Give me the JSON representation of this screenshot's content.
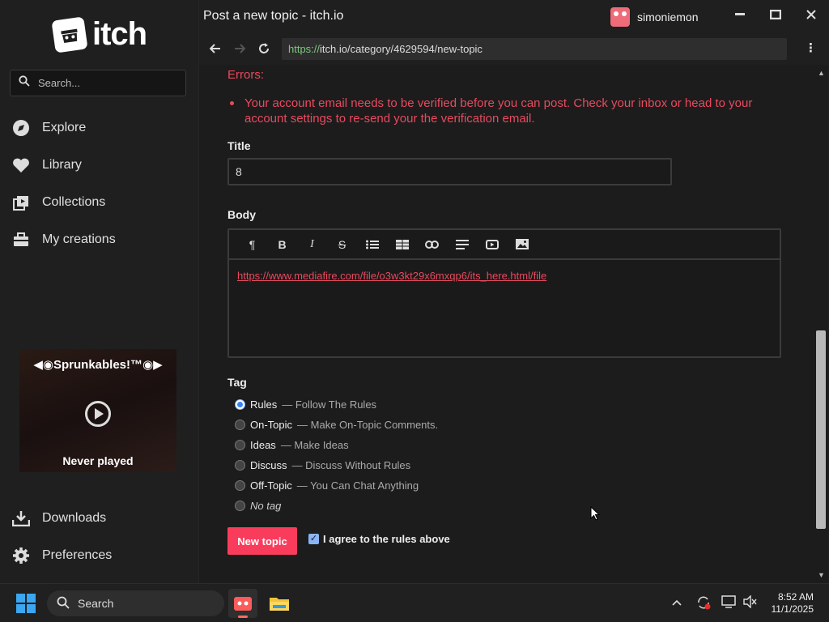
{
  "window": {
    "title": "Post a new topic - itch.io"
  },
  "user": {
    "name": "simoniemon"
  },
  "url": {
    "scheme": "https://",
    "rest": "itch.io/category/4629594/new-topic"
  },
  "sidebar": {
    "logo_text": "itch",
    "search_placeholder": "Search...",
    "items": [
      {
        "label": "Explore",
        "icon": "explore-icon"
      },
      {
        "label": "Library",
        "icon": "heart-icon"
      },
      {
        "label": "Collections",
        "icon": "collections-icon"
      },
      {
        "label": "My creations",
        "icon": "creations-icon"
      }
    ],
    "bottom_items": [
      {
        "label": "Downloads",
        "icon": "download-icon"
      },
      {
        "label": "Preferences",
        "icon": "gear-icon"
      }
    ],
    "promo": {
      "title": "◀◉Sprunkables!™◉▶",
      "subtitle": "Never played"
    }
  },
  "form": {
    "errors_label": "Errors:",
    "errors": [
      "Your account email needs to be verified before you can post. Check your inbox or head to your account settings to re-send your the verification email."
    ],
    "title_label": "Title",
    "title_value": "8",
    "body_label": "Body",
    "body_link": "https://www.mediafire.com/file/o3w3kt29x6mxqp6/its_here.html/file",
    "tag_label": "Tag",
    "tags": [
      {
        "name": "Rules",
        "desc": "— Follow The Rules",
        "selected": true
      },
      {
        "name": "On-Topic",
        "desc": "— Make On-Topic Comments.",
        "selected": false
      },
      {
        "name": "Ideas",
        "desc": "— Make Ideas",
        "selected": false
      },
      {
        "name": "Discuss",
        "desc": "— Discuss Without Rules",
        "selected": false
      },
      {
        "name": "Off-Topic",
        "desc": "— You Can Chat Anything",
        "selected": false
      }
    ],
    "no_tag_label": "No tag",
    "submit_label": "New topic",
    "agree_label": "I agree to the rules above",
    "agree_checked": true
  },
  "taskbar": {
    "search_label": "Search",
    "time": "8:52 AM",
    "date": "11/1/2025"
  },
  "colors": {
    "accent": "#fa3c5c",
    "error": "#e84a5f",
    "url_scheme": "#7ec77e"
  }
}
